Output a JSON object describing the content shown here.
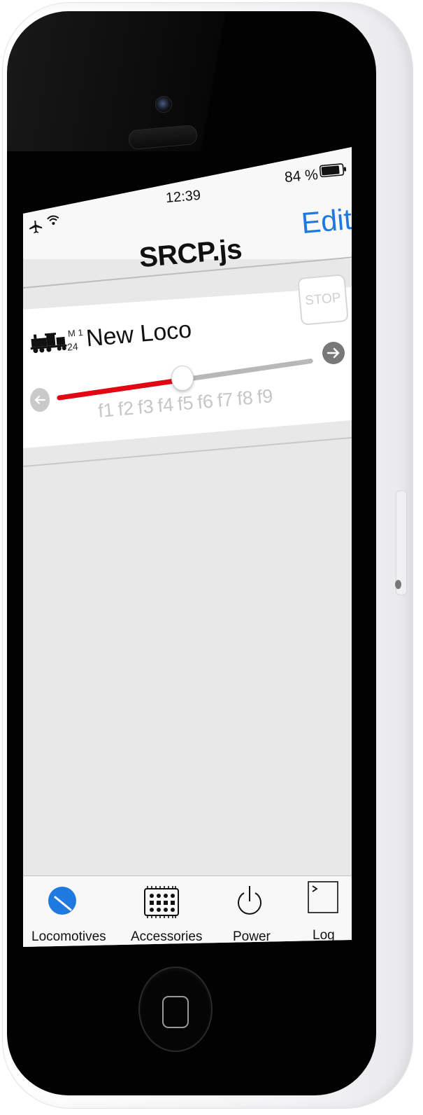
{
  "status_bar": {
    "time": "12:39",
    "battery_percent": "84 %",
    "battery_level": 0.84
  },
  "nav": {
    "title": "SRCP.js",
    "edit_label": "Edit"
  },
  "loco": {
    "protocol": "M 1",
    "address": "24",
    "name": "New Loco",
    "stop_label": "STOP",
    "speed_fraction": 0.47,
    "functions": [
      "f1",
      "f2",
      "f3",
      "f4",
      "f5",
      "f6",
      "f7",
      "f8",
      "f9"
    ]
  },
  "tabs": [
    {
      "label": "Locomotives",
      "icon": "speedometer-icon",
      "active": true
    },
    {
      "label": "Accessories",
      "icon": "switchboard-icon",
      "active": false
    },
    {
      "label": "Power",
      "icon": "power-icon",
      "active": false
    },
    {
      "label": "Log",
      "icon": "terminal-icon",
      "active": false
    }
  ],
  "colors": {
    "accent": "#1f7ae0",
    "speed_fill": "#e30613",
    "screen_bg": "#e8e8e8"
  }
}
